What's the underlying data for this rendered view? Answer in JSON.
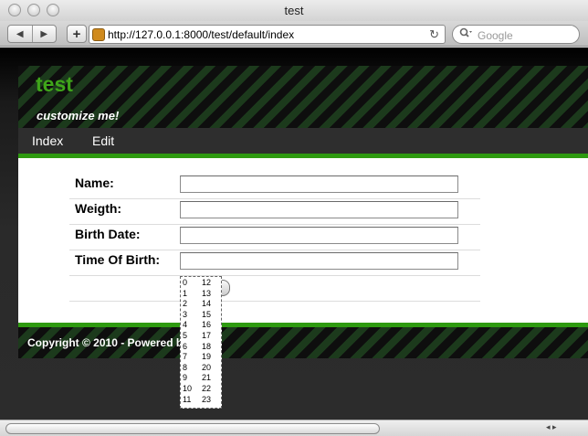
{
  "window": {
    "title": "test"
  },
  "toolbar": {
    "back_label": "◀",
    "forward_label": "▶",
    "add_label": "+",
    "url": "http://127.0.0.1:8000/test/default/index",
    "reload_label": "↻",
    "search_placeholder": "Google"
  },
  "site": {
    "title": "test",
    "subtitle": "customize me!",
    "menu": [
      {
        "label": "Index"
      },
      {
        "label": "Edit"
      }
    ]
  },
  "form": {
    "fields": [
      {
        "label": "Name:",
        "value": ""
      },
      {
        "label": "Weigth:",
        "value": ""
      },
      {
        "label": "Birth Date:",
        "value": ""
      },
      {
        "label": "Time Of Birth:",
        "value": ""
      }
    ]
  },
  "timepicker": {
    "hours_col1": [
      "0",
      "1",
      "2",
      "3",
      "4",
      "5",
      "6",
      "7",
      "8",
      "9",
      "10",
      "11"
    ],
    "hours_col2": [
      "12",
      "13",
      "14",
      "15",
      "16",
      "17",
      "18",
      "19",
      "20",
      "21",
      "22",
      "23"
    ]
  },
  "footer": {
    "copyright": "Copyright © 2010 - Powered by"
  },
  "scrollbar": {
    "arrows": "◂ ▸"
  },
  "colors": {
    "accent": "#3fa51a",
    "green_bar": "#2e9a10"
  }
}
